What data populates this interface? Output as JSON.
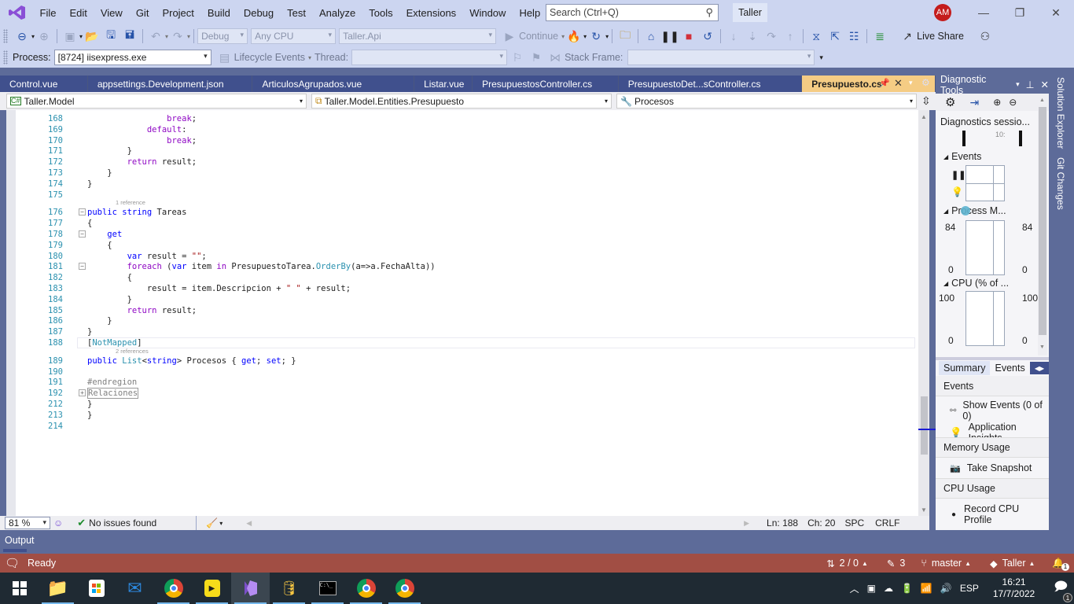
{
  "titlebar": {
    "menu": [
      "File",
      "Edit",
      "View",
      "Git",
      "Project",
      "Build",
      "Debug",
      "Test",
      "Analyze",
      "Tools",
      "Extensions",
      "Window",
      "Help"
    ],
    "search_placeholder": "Search (Ctrl+Q)",
    "solution_name": "Taller",
    "avatar_initials": "AM"
  },
  "toolbar": {
    "config": "Debug",
    "platform": "Any CPU",
    "startup_project": "Taller.Api",
    "continue_label": "Continue",
    "live_share_label": "Live Share",
    "process_label": "Process:",
    "process_value": "[8724] iisexpress.exe",
    "lifecycle_label": "Lifecycle Events",
    "thread_label": "Thread:",
    "stack_frame_label": "Stack Frame:"
  },
  "tabs": [
    {
      "label": "Control.vue",
      "active": false
    },
    {
      "label": "appsettings.Development.json",
      "active": false
    },
    {
      "label": "ArticulosAgrupados.vue",
      "active": false
    },
    {
      "label": "Listar.vue",
      "active": false
    },
    {
      "label": "PresupuestosController.cs",
      "active": false
    },
    {
      "label": "PresupuestoDet...sController.cs",
      "active": false
    },
    {
      "label": "Presupuesto.cs",
      "active": true
    }
  ],
  "navbar": {
    "project": "Taller.Model",
    "type": "Taller.Model.Entities.Presupuesto",
    "member": "Procesos"
  },
  "code_lines": [
    {
      "n": "168",
      "html": "                    <span class=\"ctl\">break</span>;"
    },
    {
      "n": "169",
      "html": "                <span class=\"ctl\">default</span>:"
    },
    {
      "n": "170",
      "html": "                    <span class=\"ctl\">break</span>;"
    },
    {
      "n": "171",
      "html": "            }"
    },
    {
      "n": "172",
      "html": "            <span class=\"ctl\">return</span> result;"
    },
    {
      "n": "173",
      "html": "        }"
    },
    {
      "n": "174",
      "html": "    }"
    },
    {
      "n": "175",
      "html": ""
    },
    {
      "n": "176",
      "html": "    <span class=\"kw\">public</span> <span class=\"kw\">string</span> Tareas",
      "lens": "1 reference",
      "fold": "-"
    },
    {
      "n": "177",
      "html": "    {"
    },
    {
      "n": "178",
      "html": "        <span class=\"kw\">get</span>",
      "fold": "-"
    },
    {
      "n": "179",
      "html": "        {"
    },
    {
      "n": "180",
      "html": "            <span class=\"kw\">var</span> result = <span class=\"str\">\"\"</span>;"
    },
    {
      "n": "181",
      "html": "            <span class=\"ctl\">foreach</span> (<span class=\"kw\">var</span> item <span class=\"ctl\">in</span> PresupuestoTarea.<span class=\"ty\">OrderBy</span>(a=>a.FechaAlta))",
      "fold": "-"
    },
    {
      "n": "182",
      "html": "            {"
    },
    {
      "n": "183",
      "html": "                result = item.Descripcion + <span class=\"str\">\" \"</span> + result;"
    },
    {
      "n": "184",
      "html": "            }"
    },
    {
      "n": "185",
      "html": "            <span class=\"ctl\">return</span> result;"
    },
    {
      "n": "186",
      "html": "        }"
    },
    {
      "n": "187",
      "html": "    }"
    },
    {
      "n": "188",
      "html": "    [<span class=\"ty\">NotMapped</span>]"
    },
    {
      "n": "189",
      "html": "    <span class=\"kw\">public</span> <span class=\"ty\">List</span>&lt;<span class=\"kw\">string</span>&gt; Procesos { <span class=\"kw\">get</span>; <span class=\"kw\">set</span>; }",
      "lens": "2 references"
    },
    {
      "n": "190",
      "html": ""
    },
    {
      "n": "191",
      "html": "    <span class=\"rg\">#endregion</span>"
    },
    {
      "n": "192",
      "html": "    <span class=\"rg\" style=\"border:1px solid #999\">Relaciones</span>",
      "fold": "+"
    },
    {
      "n": "212",
      "html": "}"
    },
    {
      "n": "213",
      "html": "}"
    },
    {
      "n": "214",
      "html": ""
    }
  ],
  "editor_status": {
    "zoom": "81 %",
    "issues": "No issues found",
    "line": "Ln: 188",
    "col": "Ch: 20",
    "whitespace": "SPC",
    "line_ending": "CRLF"
  },
  "output_label": "Output",
  "statusbar": {
    "ready": "Ready",
    "sync": "2 / 0",
    "changes": "3",
    "branch": "master",
    "repo": "Taller",
    "notifications": "1"
  },
  "diagnostics": {
    "title": "Diagnostic Tools",
    "session": "Diagnostics sessio...",
    "timeline_label": "10:",
    "events_section": "Events",
    "process_memory": "Process M...",
    "mem_max": "84",
    "mem_min": "0",
    "cpu_section": "CPU (% of ...",
    "cpu_max": "100",
    "cpu_min": "0",
    "tabs": [
      "Summary",
      "Events"
    ],
    "list": {
      "events_head": "Events",
      "show_events": "Show Events (0 of 0)",
      "app_insights": "Application Insights",
      "memory_head": "Memory Usage",
      "take_snapshot": "Take Snapshot",
      "cpu_head": "CPU Usage",
      "record_cpu": "Record CPU Profile"
    }
  },
  "side_tabs": [
    "Solution Explorer",
    "Git Changes"
  ],
  "taskbar": {
    "apps": [
      "start",
      "file-explorer",
      "store",
      "mail",
      "chrome",
      "app-yellow",
      "visual-studio",
      "db-tool",
      "terminal",
      "chrome",
      "chrome"
    ],
    "lang": "ESP",
    "time": "16:21",
    "date": "17/7/2022",
    "notif_count": "1"
  }
}
